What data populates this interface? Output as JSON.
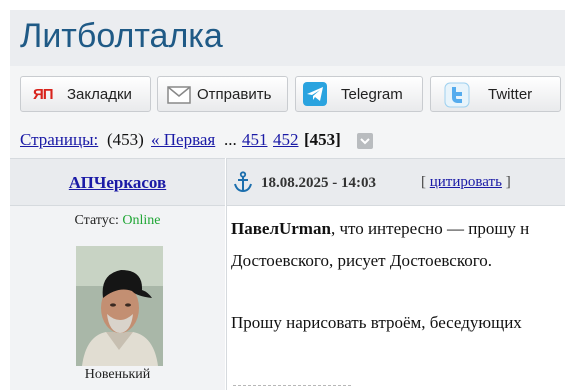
{
  "site": {
    "title": "Литболталка"
  },
  "share": {
    "buttons": [
      {
        "label": "Закладки",
        "icon": "yandex-bookmarks-icon",
        "icon_text": "ЯП"
      },
      {
        "label": "Отправить",
        "icon": "envelope-icon"
      },
      {
        "label": "Telegram",
        "icon": "telegram-icon"
      },
      {
        "label": "Twitter",
        "icon": "twitter-icon"
      }
    ]
  },
  "pager": {
    "label": "Страницы:",
    "count": "(453)",
    "first": "« Первая",
    "ellipsis": "...",
    "pages": [
      "451",
      "452"
    ],
    "current": "[453]"
  },
  "post": {
    "author": "АПЧеркасов",
    "date": "18.08.2025 - 14:03",
    "quote_open": "[",
    "quote_label": "цитировать",
    "quote_close": "]",
    "status_label": "Статус:",
    "status_value": "Online",
    "rank": "Новенький",
    "message": {
      "mention": "ПавелUrman",
      "line1_rest": ", что интересно — прошу н",
      "line2": "Достоевского, рисует Достоевского.",
      "line3": "Прошу нарисовать втроём, беседующих"
    }
  },
  "colors": {
    "title": "#1f5a86",
    "link": "#1a1aa6",
    "online": "#21a636",
    "telegram": "#2aa3df",
    "twitter": "#55acee",
    "yandex": "#d8231c"
  }
}
